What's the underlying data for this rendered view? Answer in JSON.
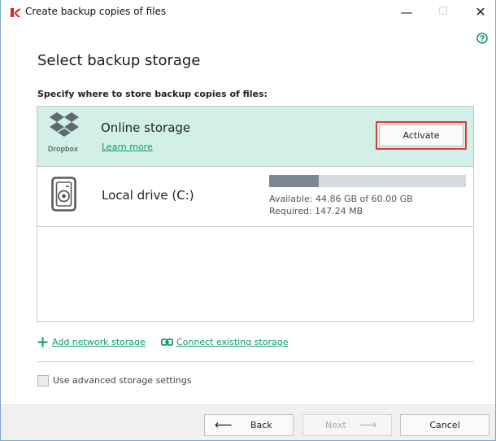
{
  "window": {
    "title": "Create backup copies of files",
    "controls": {
      "minimize": "—",
      "maximize": "☐",
      "close": "✕"
    },
    "brand_color": "#d7261f"
  },
  "page": {
    "heading": "Select backup storage",
    "subheading": "Specify where to store backup copies of files:"
  },
  "storage": {
    "online": {
      "title": "Online storage",
      "provider_label": "Dropbox",
      "learn_more": "Learn more",
      "activate_label": "Activate",
      "highlight_color": "#d83b3b",
      "background": "#d2f0e8"
    },
    "local": {
      "title": "Local drive (C:)",
      "available": "Available: 44.86 GB of 60.00 GB",
      "required": "Required: 147.24 MB",
      "used_fraction": 0.252
    }
  },
  "actions": {
    "add_network": "Add network storage",
    "connect_existing": "Connect existing storage",
    "link_color": "#159a68"
  },
  "options": {
    "advanced_label": "Use advanced storage settings",
    "advanced_checked": false
  },
  "footer": {
    "back_label": "Back",
    "next_label": "Next",
    "cancel_label": "Cancel",
    "next_enabled": false
  },
  "icons": {
    "app": "kaspersky-logo-icon",
    "help": "help-icon",
    "dropbox": "dropbox-icon",
    "drive": "hard-drive-icon",
    "add": "plus-icon",
    "link": "chain-link-icon",
    "back": "arrow-left-icon",
    "next": "arrow-right-icon"
  }
}
